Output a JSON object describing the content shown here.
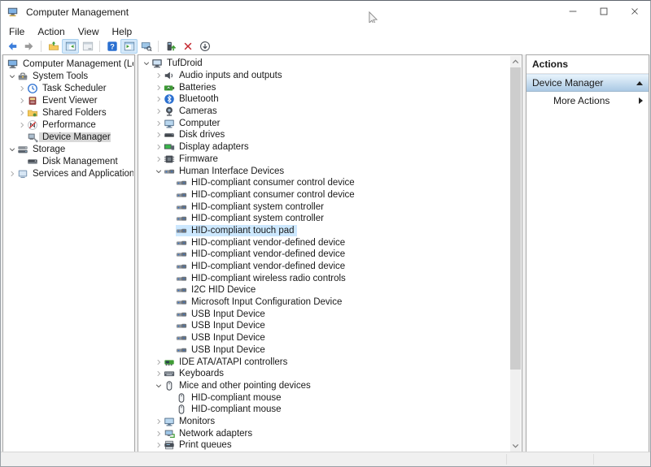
{
  "window": {
    "title": "Computer Management",
    "controls": [
      {
        "name": "minimize",
        "icon": "minimize-icon"
      },
      {
        "name": "maximize",
        "icon": "maximize-icon"
      },
      {
        "name": "close",
        "icon": "close-icon"
      }
    ]
  },
  "menu_bar": {
    "items": [
      "File",
      "Action",
      "View",
      "Help"
    ]
  },
  "toolbar": {
    "buttons": [
      {
        "name": "back",
        "icon": "back-icon",
        "state": "normal"
      },
      {
        "name": "forward",
        "icon": "forward-icon",
        "state": "disabled"
      },
      {
        "sep": true
      },
      {
        "name": "up-level",
        "icon": "up-level-icon",
        "state": "normal"
      },
      {
        "name": "show-console-tree",
        "icon": "show-console-tree-icon",
        "state": "toggled"
      },
      {
        "name": "properties",
        "icon": "properties-icon",
        "state": "disabled"
      },
      {
        "sep": true
      },
      {
        "name": "help",
        "icon": "help-icon",
        "state": "normal"
      },
      {
        "name": "show-action-pane",
        "icon": "show-action-pane-icon",
        "state": "toggled"
      },
      {
        "name": "scan-hardware-changes",
        "icon": "scan-hardware-changes-icon",
        "state": "normal"
      },
      {
        "sep": true
      },
      {
        "name": "update-driver",
        "icon": "update-driver-icon",
        "state": "normal"
      },
      {
        "name": "uninstall-device",
        "icon": "uninstall-device-icon",
        "state": "normal"
      },
      {
        "name": "disable-device",
        "icon": "disable-device-icon",
        "state": "normal"
      }
    ]
  },
  "left_tree": {
    "items": [
      {
        "label": "Computer Management (Local)",
        "icon": "computer-management-icon",
        "level": 0,
        "expander": "none"
      },
      {
        "label": "System Tools",
        "icon": "system-tools-icon",
        "level": 1,
        "expander": "expanded"
      },
      {
        "label": "Task Scheduler",
        "icon": "task-scheduler-icon",
        "level": 2,
        "expander": "collapsed"
      },
      {
        "label": "Event Viewer",
        "icon": "event-viewer-icon",
        "level": 2,
        "expander": "collapsed"
      },
      {
        "label": "Shared Folders",
        "icon": "shared-folders-icon",
        "level": 2,
        "expander": "collapsed"
      },
      {
        "label": "Performance",
        "icon": "performance-icon",
        "level": 2,
        "expander": "collapsed"
      },
      {
        "label": "Device Manager",
        "icon": "device-manager-icon",
        "level": 2,
        "expander": "none",
        "selected": "inactive"
      },
      {
        "label": "Storage",
        "icon": "storage-icon",
        "level": 1,
        "expander": "expanded"
      },
      {
        "label": "Disk Management",
        "icon": "disk-management-icon",
        "level": 2,
        "expander": "none"
      },
      {
        "label": "Services and Applications",
        "icon": "services-applications-icon",
        "level": 1,
        "expander": "collapsed"
      }
    ]
  },
  "device_tree": {
    "items": [
      {
        "label": "TufDroid",
        "icon": "computer-icon",
        "level": 0,
        "expander": "expanded"
      },
      {
        "label": "Audio inputs and outputs",
        "icon": "audio-icon",
        "level": 1,
        "expander": "collapsed"
      },
      {
        "label": "Batteries",
        "icon": "battery-icon",
        "level": 1,
        "expander": "collapsed"
      },
      {
        "label": "Bluetooth",
        "icon": "bluetooth-icon",
        "level": 1,
        "expander": "collapsed"
      },
      {
        "label": "Cameras",
        "icon": "camera-icon",
        "level": 1,
        "expander": "collapsed"
      },
      {
        "label": "Computer",
        "icon": "monitor-icon",
        "level": 1,
        "expander": "collapsed"
      },
      {
        "label": "Disk drives",
        "icon": "disk-drive-icon",
        "level": 1,
        "expander": "collapsed"
      },
      {
        "label": "Display adapters",
        "icon": "display-adapter-icon",
        "level": 1,
        "expander": "collapsed"
      },
      {
        "label": "Firmware",
        "icon": "firmware-icon",
        "level": 1,
        "expander": "collapsed"
      },
      {
        "label": "Human Interface Devices",
        "icon": "hid-icon",
        "level": 1,
        "expander": "expanded"
      },
      {
        "label": "HID-compliant consumer control device",
        "icon": "hid-icon",
        "level": 2,
        "expander": "none"
      },
      {
        "label": "HID-compliant consumer control device",
        "icon": "hid-icon",
        "level": 2,
        "expander": "none"
      },
      {
        "label": "HID-compliant system controller",
        "icon": "hid-icon",
        "level": 2,
        "expander": "none"
      },
      {
        "label": "HID-compliant system controller",
        "icon": "hid-icon",
        "level": 2,
        "expander": "none"
      },
      {
        "label": "HID-compliant touch pad",
        "icon": "hid-icon",
        "level": 2,
        "expander": "none",
        "selected": "active"
      },
      {
        "label": "HID-compliant vendor-defined device",
        "icon": "hid-icon",
        "level": 2,
        "expander": "none"
      },
      {
        "label": "HID-compliant vendor-defined device",
        "icon": "hid-icon",
        "level": 2,
        "expander": "none"
      },
      {
        "label": "HID-compliant vendor-defined device",
        "icon": "hid-icon",
        "level": 2,
        "expander": "none"
      },
      {
        "label": "HID-compliant wireless radio controls",
        "icon": "hid-icon",
        "level": 2,
        "expander": "none"
      },
      {
        "label": "I2C HID Device",
        "icon": "hid-icon",
        "level": 2,
        "expander": "none"
      },
      {
        "label": "Microsoft Input Configuration Device",
        "icon": "hid-icon",
        "level": 2,
        "expander": "none"
      },
      {
        "label": "USB Input Device",
        "icon": "hid-icon",
        "level": 2,
        "expander": "none"
      },
      {
        "label": "USB Input Device",
        "icon": "hid-icon",
        "level": 2,
        "expander": "none"
      },
      {
        "label": "USB Input Device",
        "icon": "hid-icon",
        "level": 2,
        "expander": "none"
      },
      {
        "label": "USB Input Device",
        "icon": "hid-icon",
        "level": 2,
        "expander": "none"
      },
      {
        "label": "IDE ATA/ATAPI controllers",
        "icon": "ide-icon",
        "level": 1,
        "expander": "collapsed"
      },
      {
        "label": "Keyboards",
        "icon": "keyboard-icon",
        "level": 1,
        "expander": "collapsed"
      },
      {
        "label": "Mice and other pointing devices",
        "icon": "mouse-icon",
        "level": 1,
        "expander": "expanded"
      },
      {
        "label": "HID-compliant mouse",
        "icon": "mouse-icon",
        "level": 2,
        "expander": "none"
      },
      {
        "label": "HID-compliant mouse",
        "icon": "mouse-icon",
        "level": 2,
        "expander": "none"
      },
      {
        "label": "Monitors",
        "icon": "monitor-icon",
        "level": 1,
        "expander": "collapsed"
      },
      {
        "label": "Network adapters",
        "icon": "network-icon",
        "level": 1,
        "expander": "collapsed"
      },
      {
        "label": "Print queues",
        "icon": "printer-icon",
        "level": 1,
        "expander": "collapsed"
      },
      {
        "label": "",
        "icon": "partial-device-icon",
        "level": 1,
        "expander": "collapsed"
      }
    ]
  },
  "actions_pane": {
    "title": "Actions",
    "section_label": "Device Manager",
    "more_actions_label": "More Actions"
  }
}
